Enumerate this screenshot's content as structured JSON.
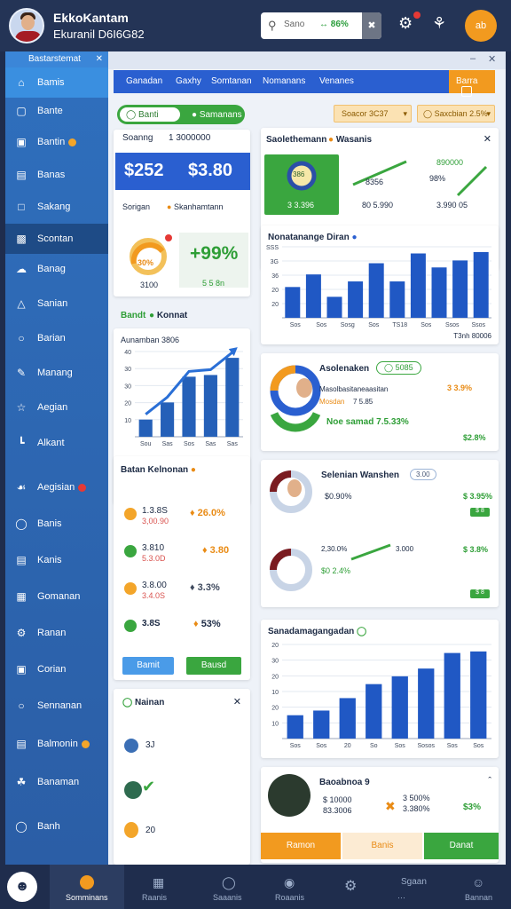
{
  "header": {
    "name": "EkkoKantam",
    "subtitle": "Ekuranil D6I6G82",
    "search_placeholder": "Sano",
    "search_stat": "86%",
    "orange_btn": "ab"
  },
  "sidebar": {
    "title": "Bastarstemat",
    "items": [
      {
        "label": "Bamis"
      },
      {
        "label": "Bante"
      },
      {
        "label": "Bantin"
      },
      {
        "label": "Banas"
      },
      {
        "label": "Sakang"
      },
      {
        "label": "Scontan"
      },
      {
        "label": "Banag"
      },
      {
        "label": "Sanian"
      },
      {
        "label": "Barian"
      },
      {
        "label": "Manang"
      },
      {
        "label": "Aegian"
      },
      {
        "label": "Alkant"
      },
      {
        "label": "Aegisian"
      },
      {
        "label": "Banis"
      },
      {
        "label": "Kanis"
      },
      {
        "label": "Gomanan"
      },
      {
        "label": "Ranan"
      },
      {
        "label": "Corian"
      },
      {
        "label": "Sennanan"
      },
      {
        "label": "Balmonin"
      },
      {
        "label": "Banaman"
      },
      {
        "label": "Banh"
      }
    ]
  },
  "tabs": [
    "Ganadan",
    "Gaxhy",
    "Somtanan",
    "Nomanans",
    "Venanes"
  ],
  "tab_active": "Barra",
  "left": {
    "toggle_left": "Banti",
    "toggle_right": "Samanans",
    "card1_label": "Soanng",
    "card1_code": "1 3000000",
    "value_a": "$252",
    "value_b": "$3.80",
    "card1_foot_left": "Sorigan",
    "card1_foot_right": "Skanhamtann",
    "gauge_value": "30%",
    "gauge_sub": "3100",
    "pct_big": "+99%",
    "pct_sub": "5 5 8n",
    "section2_left": "Bandt",
    "section2_right": "Konnat",
    "chart_title": "Aunamban 3806",
    "list_title": "Batan Kelnonan",
    "list_items": [
      {
        "a": "1.3.8S",
        "b": "3,00.90",
        "right": "26.0%"
      },
      {
        "a": "3.810",
        "b": "5.3.0D",
        "right": "3.80"
      },
      {
        "a": "3.8.00",
        "b": "3.4.0S",
        "right": "3.3%"
      },
      {
        "a": "3.8S",
        "b": "",
        "right": "53%"
      }
    ],
    "btn_blue": "Bamit",
    "btn_green": "Bausd",
    "bottom_title": "Nainan",
    "bottom_items": [
      {
        "label": "3J"
      },
      {
        "label": ""
      },
      {
        "label": "20"
      }
    ]
  },
  "right": {
    "dropdown1": "Soacor 3C37",
    "dropdown2": "Saxcbian 2.5%",
    "panel_title": "Saolethemann",
    "panel_title2": "Wasanis",
    "tile1_value": "386",
    "tile1_sub": "3 3.396",
    "tile2_value": "8356",
    "tile2_sub": "80 5.990",
    "tile3_value": "890000",
    "tile3_pct": "98%",
    "tile3_sub": "3.990 05",
    "bar_title": "Nonatanange Diran",
    "bar_foot": "T3nh 80006",
    "card_asia_title": "Asolenaken",
    "card_asia_badge": "5085",
    "card_asia_line1": "Masolbasitaneaasitan",
    "card_asia_line1_val": "3 3.9%",
    "card_asia_line2": "Mosdan",
    "card_asia_line2_val": "7 5.85",
    "card_asia_line3": "Noe samad 7.5.33%",
    "card_asia_foot": "$2.8%",
    "card_sel_title": "Selenian Wanshen",
    "card_sel_badge": "3.00",
    "card_sel_a": "$0.90%",
    "card_sel_a_val": "$ 3.95%",
    "card_sel_b": "2,30.0%",
    "card_sel_b2": "3.000",
    "card_sel_b_val": "$ 3.8%",
    "card_sel_c": "$0 2.4%",
    "card_sel_small1": "$ 8",
    "card_sel_small2": "$ 8",
    "bar2_title": "Sanadamagangadan",
    "bottom_title": "Baoabnoa 9",
    "bottom_line1": "$ 10000",
    "bottom_line2": "83.3006",
    "bottom_mid1": "3 500%",
    "bottom_mid2": "3.380%",
    "bottom_pct": "$3%",
    "btn_orange": "Ramon",
    "btn_light": "Banis",
    "btn_green": "Danat"
  },
  "bottom_nav": [
    {
      "label": "Somminans"
    },
    {
      "label": "Raanis"
    },
    {
      "label": "Saaanis"
    },
    {
      "label": "Roaanis"
    },
    {
      "label": ""
    },
    {
      "label": "Sgaan"
    },
    {
      "label": "Bannan"
    }
  ],
  "charts": {
    "rising_bars": [
      1,
      2,
      3.5,
      3.6,
      4.6
    ],
    "rising_xlabels": [
      "Sou",
      "Sas",
      "Sos",
      "Sas",
      "Sas"
    ],
    "rising_ylabels": [
      "40",
      "30",
      "30",
      "20",
      "10"
    ],
    "right_bars": [
      44,
      62,
      30,
      52,
      78,
      52,
      92,
      72,
      82,
      94
    ],
    "right_xlabels": [
      "Sos",
      "Sos",
      "Sosg",
      "Sos",
      "TS18",
      "Sos",
      "Ssos",
      "Ssos"
    ],
    "right_ylabels": [
      "SSS",
      "3G",
      "36",
      "20",
      "20"
    ],
    "bottom_bars": [
      30,
      36,
      52,
      70,
      80,
      90,
      110,
      112
    ],
    "bottom_xlabels": [
      "Sos",
      "Sos",
      "20",
      "So",
      "Sos",
      "Sosos",
      "Sos",
      "Sos"
    ],
    "bottom_ylabels": [
      "20",
      "30",
      "20",
      "10",
      "20",
      "10"
    ]
  },
  "colors": {
    "primary_blue": "#2a5fd0",
    "sidebar_blue": "#2f6fbd",
    "accent_orange": "#f29a1f",
    "accent_green": "#3aa63f",
    "topbar": "#243456"
  }
}
